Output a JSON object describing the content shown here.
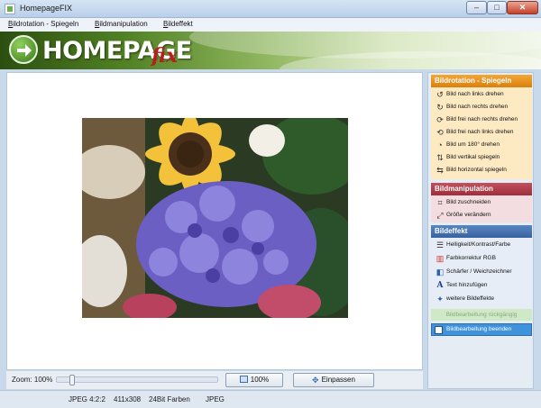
{
  "window": {
    "title": "HomepageFIX"
  },
  "menu": [
    "Bildrotation - Spiegeln",
    "Bildmanipulation",
    "Bildeffekt"
  ],
  "banner": {
    "logo_text": "HOMEPAGE",
    "logo_suffix": "fix"
  },
  "sidebar": {
    "rotation": {
      "header": "Bildrotation - Spiegeln",
      "items": [
        {
          "label": "Bild nach links drehen",
          "icon": "rotate-left-icon"
        },
        {
          "label": "Bild nach rechts drehen",
          "icon": "rotate-right-icon"
        },
        {
          "label": "Bild frei nach rechts drehen",
          "icon": "free-rotate-right-icon"
        },
        {
          "label": "Bild frei nach links drehen",
          "icon": "free-rotate-left-icon"
        },
        {
          "label": "Bild um 180° drehen",
          "icon": "rotate-180-icon"
        },
        {
          "label": "Bild vertikal spiegeln",
          "icon": "flip-vertical-icon"
        },
        {
          "label": "Bild horizontal spiegeln",
          "icon": "flip-horizontal-icon"
        }
      ]
    },
    "manipulation": {
      "header": "Bildmanipulation",
      "items": [
        {
          "label": "Bild zuschneiden",
          "icon": "crop-icon"
        },
        {
          "label": "Größe verändern",
          "icon": "resize-icon"
        }
      ]
    },
    "effects": {
      "header": "Bildeffekt",
      "items": [
        {
          "label": "Helligkeit/Kontrast/Farbe",
          "icon": "brightness-icon"
        },
        {
          "label": "Farbkorrektur RGB",
          "icon": "rgb-icon"
        },
        {
          "label": "Schärfer / Weichzeichner",
          "icon": "sharpen-icon"
        },
        {
          "label": "Text hinzufügen",
          "icon": "text-icon"
        },
        {
          "label": "weitere Bildeffekte",
          "icon": "effects-icon"
        }
      ]
    },
    "undo_label": "Bildbearbeitung rückgängig",
    "finish_label": "Bildbearbeitung beenden"
  },
  "zoom": {
    "label": "Zoom: 100%",
    "value_percent": 100,
    "btn_100": "100%",
    "btn_fit": "Einpassen"
  },
  "status": {
    "format": "JPEG 4:2:2",
    "dimensions": "411x308",
    "colors": "24Bit Farben",
    "type": "JPEG"
  },
  "colors": {
    "orange": "#db7f0e",
    "red": "#9e2e3b",
    "blue": "#3762a0",
    "finish_button": "#3f93dd"
  }
}
